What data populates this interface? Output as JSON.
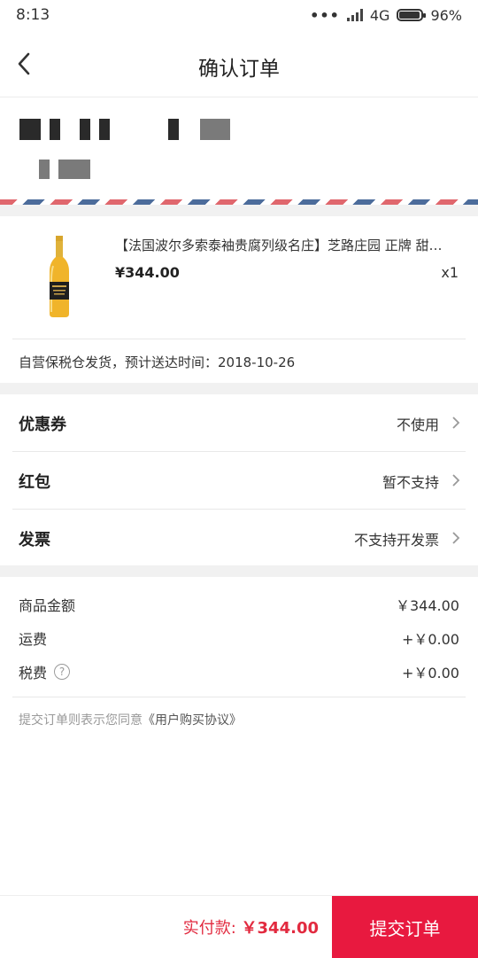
{
  "status_bar": {
    "time": "8:13",
    "network": "4G",
    "battery": "96%",
    "battery_level": 0.96
  },
  "header": {
    "title": "确认订单"
  },
  "product": {
    "name": "【法国波尔多索泰袖贵腐列级名庄】芝路庄园 正牌 甜…",
    "price": "¥344.00",
    "quantity": "x1",
    "shipping_note": "自营保税仓发货，预计送达时间：2018-10-26"
  },
  "options": [
    {
      "label": "优惠券",
      "value": "不使用"
    },
    {
      "label": "红包",
      "value": "暂不支持"
    },
    {
      "label": "发票",
      "value": "不支持开发票"
    }
  ],
  "amounts": {
    "goods_label": "商品金额",
    "goods_value": "￥344.00",
    "freight_label": "运费",
    "freight_value": "+￥0.00",
    "tax_label": "税费",
    "tax_value": "+￥0.00",
    "tax_help": "?"
  },
  "agreement": {
    "prefix": "提交订单则表示您同意",
    "link": "《用户购买协议》"
  },
  "footer": {
    "pay_label": "实付款:",
    "pay_amount": "￥344.00",
    "submit_label": "提交订单"
  },
  "colors": {
    "accent": "#e8193f",
    "price_red": "#e22a3f",
    "airmail_red": "#e0676d",
    "airmail_blue": "#4c6c9b"
  }
}
